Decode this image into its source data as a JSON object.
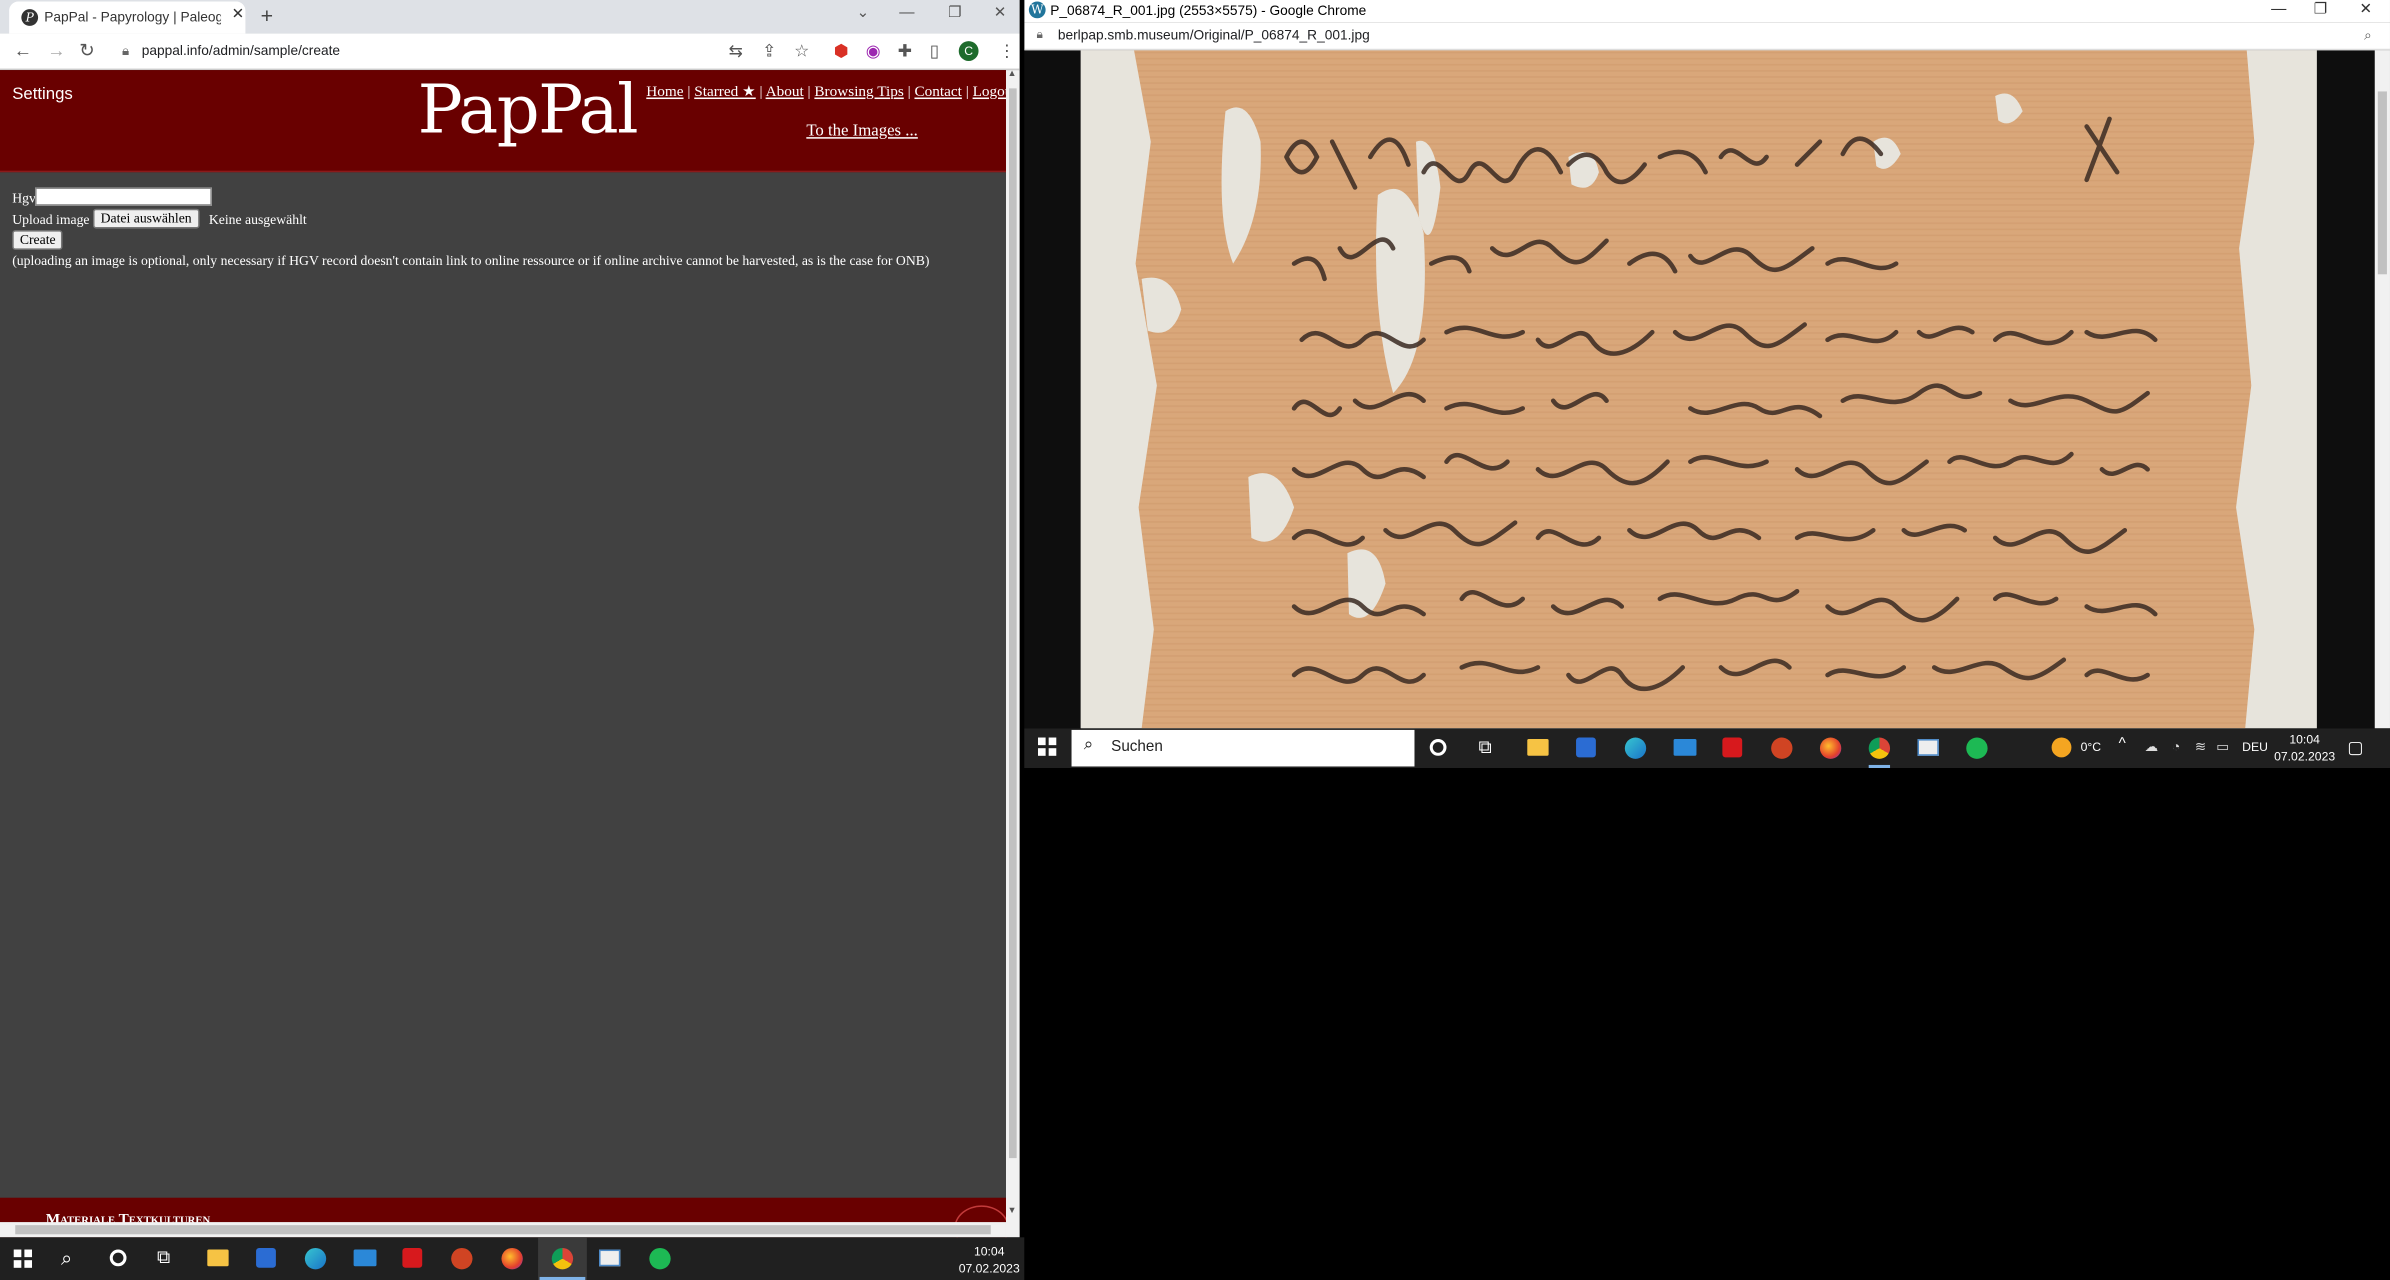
{
  "left_window": {
    "tab_title": "PapPal - Papyrology | Paleography",
    "tab_favicon": "pappal-favicon-icon",
    "url": "pappal.info/admin/sample/create",
    "avatar_letter": "C",
    "page": {
      "settings_label": "Settings",
      "logo_text": "PapPal",
      "nav": [
        "Home",
        "Starred ★",
        "About",
        "Browsing Tips",
        "Contact",
        "Logout"
      ],
      "nav_separator": "|",
      "to_images_label": "To the Images ...",
      "form": {
        "hgv_label": "Hgv",
        "hgv_value": "",
        "upload_label": "Upload image",
        "file_button_label": "Datei auswählen",
        "file_status": "Keine ausgewählt",
        "create_button_label": "Create",
        "note": "(uploading an image is optional, only necessary if HGV record doesn't contain link to online ressource or if online archive cannot be harvested, as is the case for ONB)"
      },
      "footer_text": "Materiale Textkulturen",
      "banner_color": "#690000",
      "page_bg_color": "#414141"
    }
  },
  "right_window": {
    "title": "P_06874_R_001.jpg (2553×5575) - Google Chrome",
    "url": "berlpap.smb.museum/Original/P_06874_R_001.jpg",
    "image_description_icon": "papyrus-image"
  },
  "taskbar_right": {
    "search_placeholder": "Suchen",
    "weather": "0°C",
    "language": "DEU",
    "time": "10:04",
    "date": "07.02.2023"
  },
  "taskbar_left": {
    "time": "10:04",
    "date": "07.02.2023"
  },
  "taskbar_icons": [
    "start-icon",
    "search-icon",
    "cortana-icon",
    "task-view-icon",
    "file-explorer-icon",
    "store-icon",
    "edge-icon",
    "mail-icon",
    "acrobat-icon",
    "powerpoint-icon",
    "firefox-icon",
    "chrome-icon",
    "notepad-icon",
    "spotify-icon"
  ]
}
